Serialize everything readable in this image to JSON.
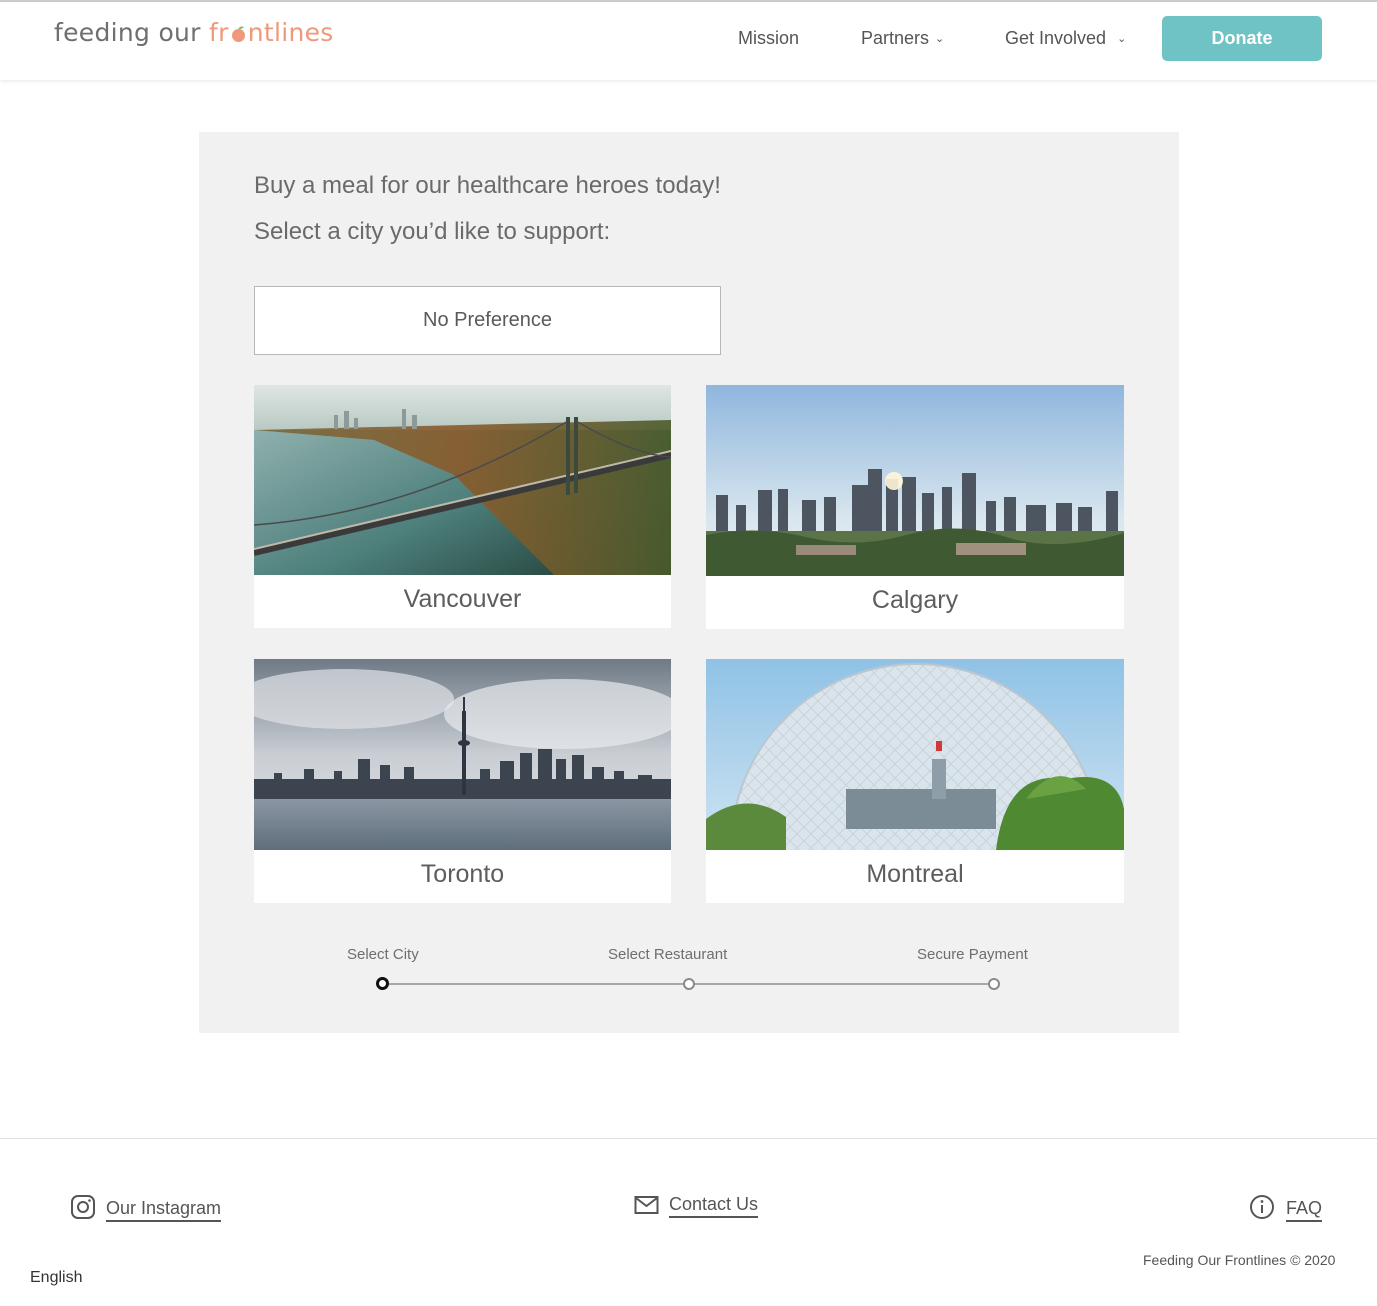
{
  "header": {
    "logo_part1": "feeding our ",
    "logo_part2a": "fr",
    "logo_part2b": "ntlines",
    "nav": {
      "mission": "Mission",
      "partners": "Partners",
      "get_involved": "Get Involved",
      "donate": "Donate"
    }
  },
  "main": {
    "headline": "Buy a meal for our healthcare heroes today!",
    "subheadline": "Select a city you’d like to support:",
    "no_preference": "No Preference",
    "cities": {
      "vancouver": "Vancouver",
      "calgary": "Calgary",
      "toronto": "Toronto",
      "montreal": "Montreal"
    }
  },
  "steps": {
    "current_step": 1,
    "labels": [
      "Select City",
      "Select Restaurant",
      "Secure Payment"
    ]
  },
  "footer": {
    "instagram": "Our Instagram",
    "contact": "Contact Us",
    "faq": "FAQ",
    "copyright": "Feeding Our Frontlines © 2020",
    "language": "English"
  },
  "colors": {
    "accent": "#6fc3c5",
    "logo_orange": "#f0987a",
    "panel_bg": "#f1f1f1",
    "text": "#616161"
  }
}
